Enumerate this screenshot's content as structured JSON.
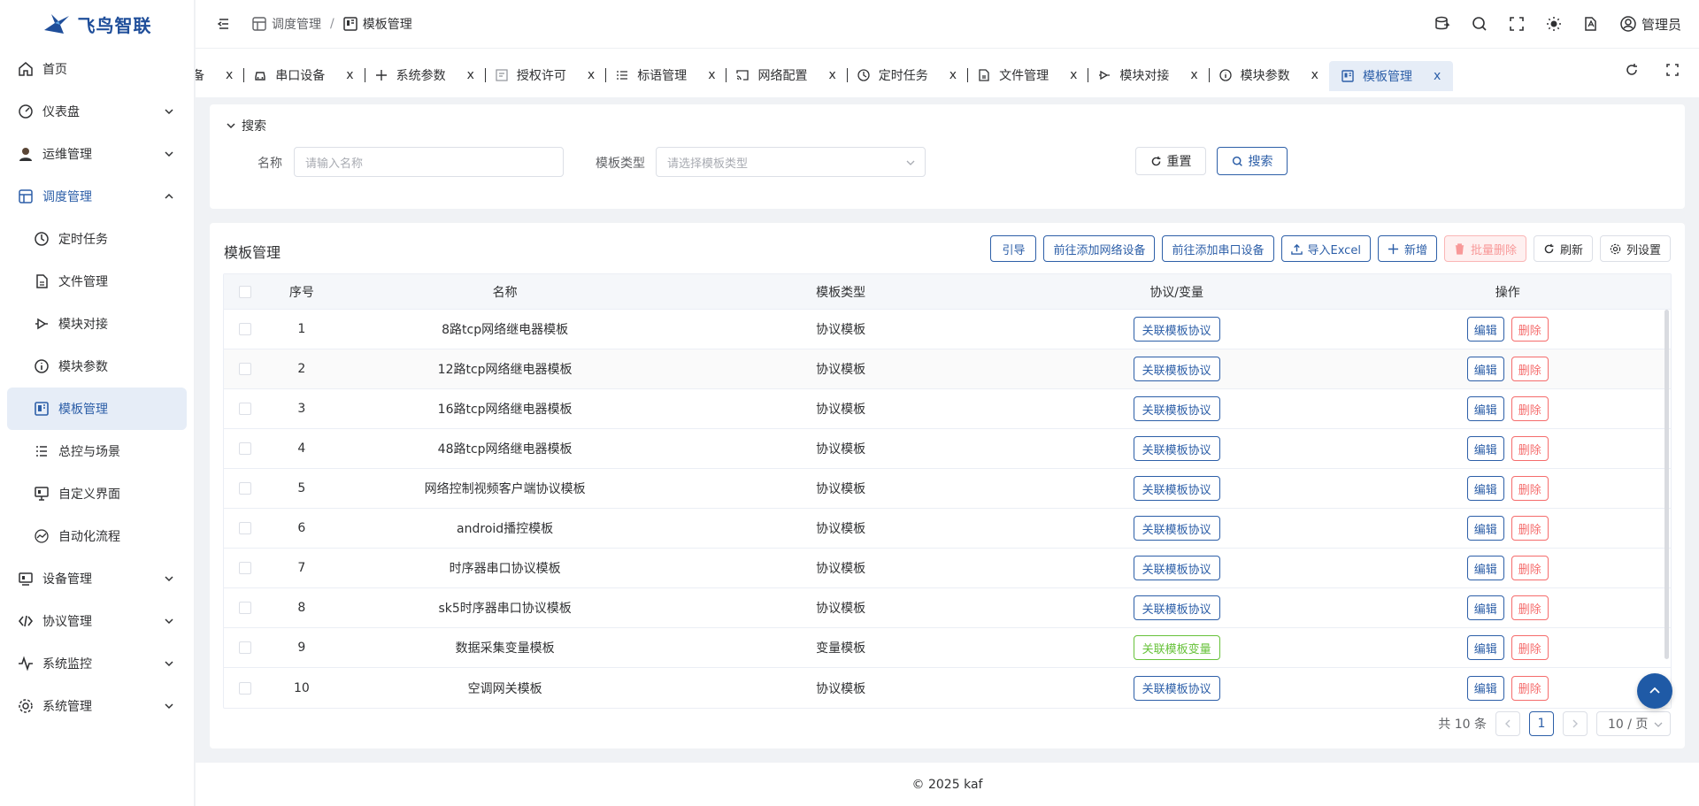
{
  "app": {
    "name": "飞鸟智联"
  },
  "colors": {
    "brand": "#2d5fa8",
    "danger": "#f56c6c",
    "success": "#67c23a",
    "active_bg": "#e6edf7"
  },
  "sidebar": {
    "items": [
      {
        "label": "首页",
        "icon": "home-icon"
      },
      {
        "label": "仪表盘",
        "icon": "dashboard-icon"
      },
      {
        "label": "运维管理",
        "icon": "user-icon"
      },
      {
        "label": "调度管理",
        "icon": "schedule-icon"
      },
      {
        "label": "定时任务",
        "icon": "clock-icon"
      },
      {
        "label": "文件管理",
        "icon": "file-icon"
      },
      {
        "label": "模块对接",
        "icon": "module-icon"
      },
      {
        "label": "模块参数",
        "icon": "info-icon"
      },
      {
        "label": "模板管理",
        "icon": "template-icon"
      },
      {
        "label": "总控与场景",
        "icon": "list-icon"
      },
      {
        "label": "自定义界面",
        "icon": "monitor-icon"
      },
      {
        "label": "自动化流程",
        "icon": "flow-icon"
      },
      {
        "label": "设备管理",
        "icon": "device-icon"
      },
      {
        "label": "协议管理",
        "icon": "protocol-icon"
      },
      {
        "label": "系统监控",
        "icon": "pulse-icon"
      },
      {
        "label": "系统管理",
        "icon": "gear-icon"
      }
    ]
  },
  "header": {
    "breadcrumb": [
      "调度管理",
      "/",
      "模板管理"
    ],
    "user": "管理员"
  },
  "tabs": [
    {
      "label": "设备"
    },
    {
      "label": "串口设备"
    },
    {
      "label": "系统参数"
    },
    {
      "label": "授权许可"
    },
    {
      "label": "标语管理"
    },
    {
      "label": "网络配置"
    },
    {
      "label": "定时任务"
    },
    {
      "label": "文件管理"
    },
    {
      "label": "模块对接"
    },
    {
      "label": "模块参数"
    },
    {
      "label": "模板管理"
    }
  ],
  "tab_close": "x",
  "search": {
    "title": "搜索",
    "name_label": "名称",
    "name_placeholder": "请输入名称",
    "type_label": "模板类型",
    "type_placeholder": "请选择模板类型",
    "reset": "重置",
    "submit": "搜索"
  },
  "table": {
    "title": "模板管理",
    "toolbar": {
      "guide": "引导",
      "add_net": "前往添加网络设备",
      "add_serial": "前往添加串口设备",
      "import": "导入Excel",
      "add": "新增",
      "batch_delete": "批量删除",
      "refresh": "刷新",
      "columns": "列设置"
    },
    "columns": [
      "序号",
      "名称",
      "模板类型",
      "协议/变量",
      "操作"
    ],
    "edit": "编辑",
    "delete": "删除",
    "rows": [
      {
        "no": "1",
        "name": "8路tcp网络继电器模板",
        "type": "协议模板",
        "link": "关联模板协议"
      },
      {
        "no": "2",
        "name": "12路tcp网络继电器模板",
        "type": "协议模板",
        "link": "关联模板协议"
      },
      {
        "no": "3",
        "name": "16路tcp网络继电器模板",
        "type": "协议模板",
        "link": "关联模板协议"
      },
      {
        "no": "4",
        "name": "48路tcp网络继电器模板",
        "type": "协议模板",
        "link": "关联模板协议"
      },
      {
        "no": "5",
        "name": "网络控制视频客户端协议模板",
        "type": "协议模板",
        "link": "关联模板协议"
      },
      {
        "no": "6",
        "name": "android播控模板",
        "type": "协议模板",
        "link": "关联模板协议"
      },
      {
        "no": "7",
        "name": "时序器串口协议模板",
        "type": "协议模板",
        "link": "关联模板协议"
      },
      {
        "no": "8",
        "name": "sk5时序器串口协议模板",
        "type": "协议模板",
        "link": "关联模板协议"
      },
      {
        "no": "9",
        "name": "数据采集变量模板",
        "type": "变量模板",
        "link": "关联模板变量"
      },
      {
        "no": "10",
        "name": "空调网关模板",
        "type": "协议模板",
        "link": "关联模板协议"
      }
    ]
  },
  "pagination": {
    "total": "共 10 条",
    "current": "1",
    "size": "10 / 页"
  },
  "footer": {
    "text": "© 2025 kaf"
  }
}
